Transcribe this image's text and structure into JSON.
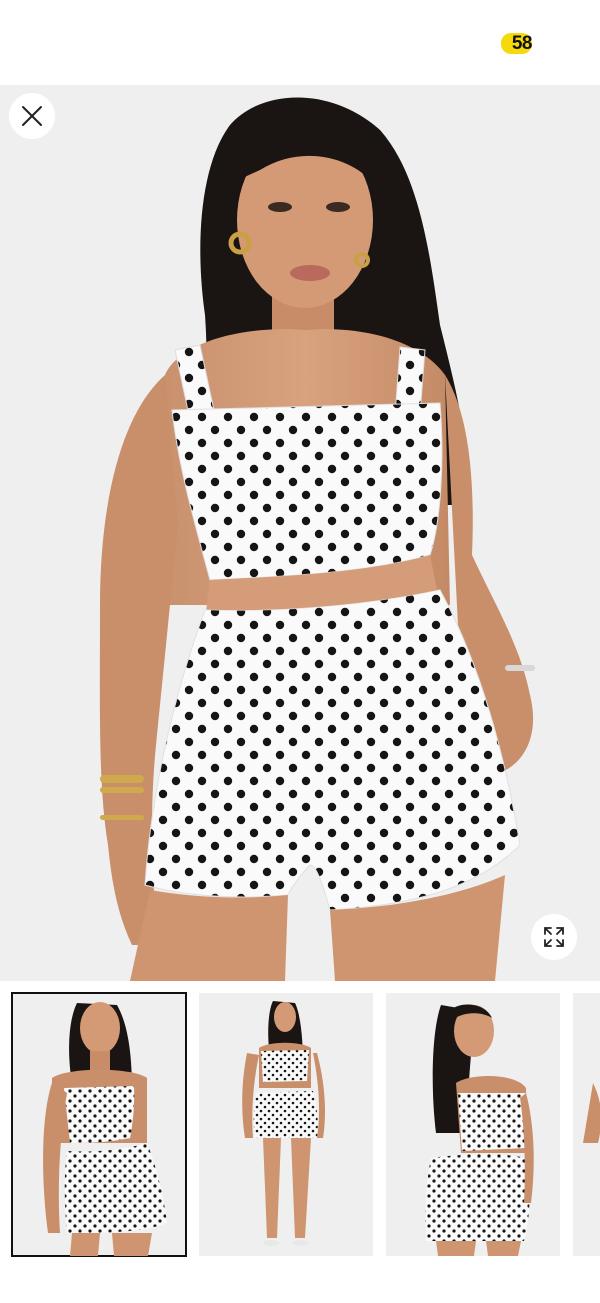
{
  "header": {
    "badge_count": "58",
    "badge_color": "#f5d90a"
  },
  "hero": {
    "close_icon": "close-icon",
    "expand_icon": "expand-icon",
    "image_subject": "model-polka-dot-two-piece-front"
  },
  "thumbnails": [
    {
      "view": "front-close",
      "selected": true
    },
    {
      "view": "front-full",
      "selected": false
    },
    {
      "view": "back",
      "selected": false
    },
    {
      "view": "partial",
      "selected": false
    }
  ]
}
